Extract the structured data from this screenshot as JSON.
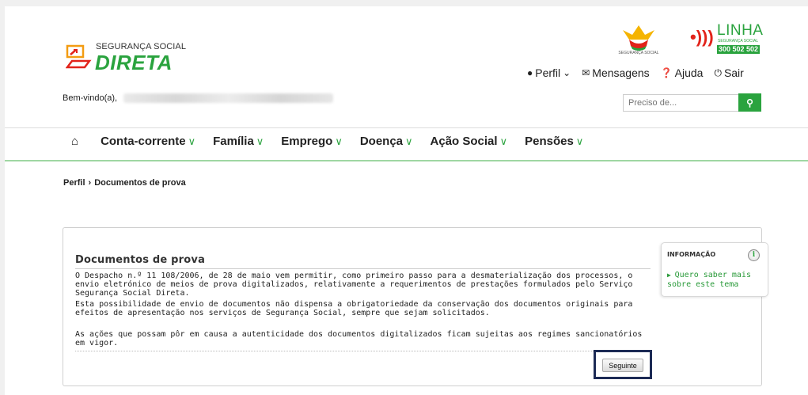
{
  "header": {
    "logo_small": "SEGURANÇA SOCIAL",
    "logo_big": "DIRETA",
    "ss_logo_text": "SEGURANÇA SOCIAL",
    "linha": {
      "title": "LINHA",
      "subtitle": "SEGURANÇA SOCIAL",
      "number": "300 502 502"
    },
    "nav": {
      "perfil": "Perfil",
      "mensagens": "Mensagens",
      "ajuda": "Ajuda",
      "sair": "Sair"
    },
    "welcome": "Bem-vindo(a),",
    "search": {
      "placeholder": "Preciso de..."
    }
  },
  "menu": {
    "items": [
      "Conta-corrente",
      "Família",
      "Emprego",
      "Doença",
      "Ação Social",
      "Pensões"
    ]
  },
  "breadcrumb": {
    "root": "Perfil",
    "separator": "›",
    "current": "Documentos de prova"
  },
  "content": {
    "title": "Documentos de prova",
    "p1": "O Despacho n.º 11 108/2006, de 28 de maio vem permitir, como primeiro passo para a desmaterialização  dos processos, o envio eletrónico de meios de prova digitalizados, relativamente a requerimentos de prestações formulados pelo Serviço Segurança Social Direta.",
    "p2": "Esta possibilidade de envio de documentos não dispensa a obrigatoriedade da conservação dos documentos originais para efeitos de apresentação nos serviços de Segurança Social, sempre que sejam solicitados.",
    "p3": "As ações que possam pôr em causa a autenticidade dos documentos digitalizados ficam sujeitas aos regimes sancionatórios em vigor.",
    "next_button": "Seguinte"
  },
  "info": {
    "title": "INFORMAÇÃO",
    "icon_letter": "i",
    "link": "Quero saber mais sobre este tema"
  },
  "colors": {
    "brand_green": "#2aa33e",
    "highlight_frame": "#1c2a55"
  }
}
